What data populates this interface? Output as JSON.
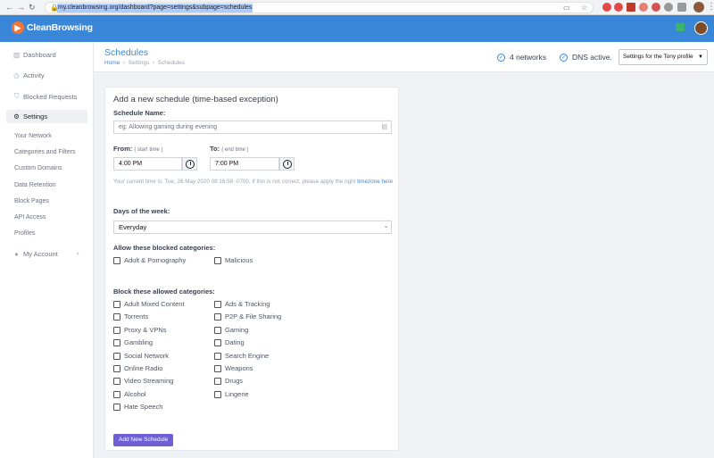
{
  "browser": {
    "url": "my.cleanbrowsing.org/dashboard?page=settings&subpage=schedules"
  },
  "app": {
    "brand": "CleanBrowsing",
    "accent": "#3a86d9"
  },
  "sidebar": {
    "items": [
      {
        "label": "Dashboard"
      },
      {
        "label": "Activity"
      },
      {
        "label": "Blocked Requests"
      },
      {
        "label": "Settings"
      }
    ],
    "subitems": [
      "Your Network",
      "Categories and Filters",
      "Custom Domains",
      "Data Retention",
      "Block Pages",
      "API Access",
      "Profiles"
    ],
    "account": "My Account"
  },
  "header": {
    "title": "Schedules",
    "crumbs": [
      "Home",
      "Settings",
      "Schedules"
    ],
    "networks": "4 networks",
    "dns": "DNS active.",
    "profile": "Settings for the Tony profile"
  },
  "form": {
    "heading": "Add a new schedule (time-based exception)",
    "name_label": "Schedule Name:",
    "name_placeholder": "eg: Allowing gaming during evening",
    "from_label": "From:",
    "from_hint": "( start time )",
    "from_value": "4:00 PM",
    "to_label": "To:",
    "to_hint": "( end time )",
    "to_value": "7:00 PM",
    "note_text": "Your current time is: Tue, 26 May 2020 08:16:58 -0700, if this is not correct, please apply the right",
    "note_link": "timezone here",
    "days_label": "Days of the week:",
    "days_value": "Everyday",
    "allow_label": "Allow these blocked categories:",
    "allow": [
      "Adult & Pornography",
      "Malicious"
    ],
    "block_label": "Block these allowed categories:",
    "block_left": [
      "Adult Mixed Content",
      "Torrents",
      "Proxy & VPNs",
      "Gambling",
      "Social Network",
      "Online Radio",
      "Video Streaming",
      "Alcohol",
      "Hate Speech"
    ],
    "block_right": [
      "Ads & Tracking",
      "P2P & File Sharing",
      "Gaming",
      "Dating",
      "Search Engine",
      "Weapons",
      "Drugs",
      "Lingerie"
    ],
    "submit": "Add New Schedule"
  }
}
